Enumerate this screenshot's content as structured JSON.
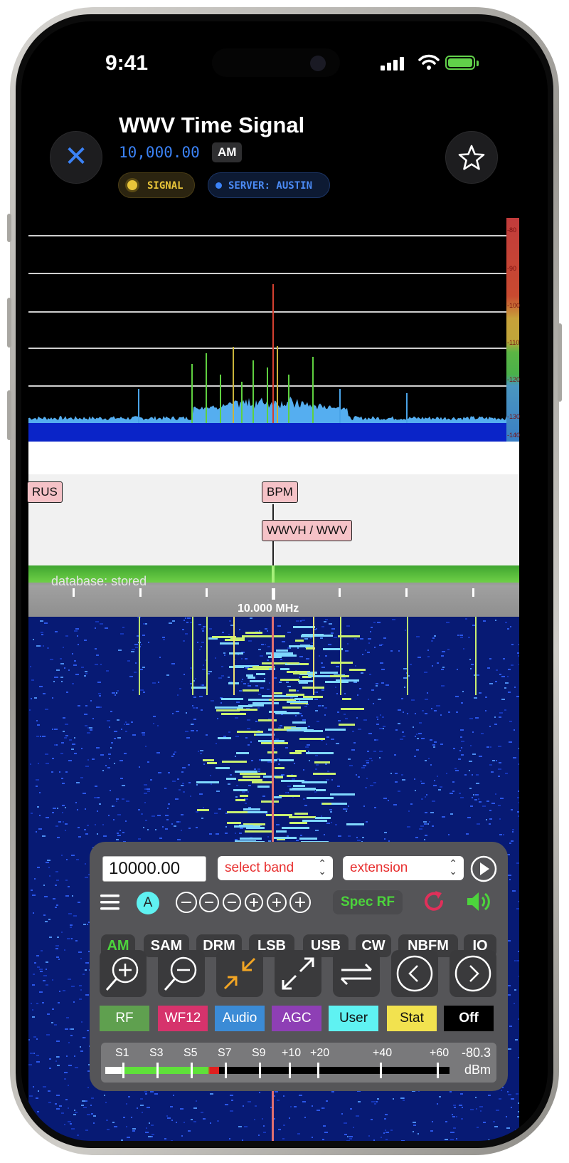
{
  "status": {
    "time": "9:41"
  },
  "header": {
    "title": "WWV Time Signal",
    "frequency": "10,000.00",
    "mode": "AM",
    "chips": {
      "signal": "SIGNAL",
      "server": "SERVER: AUSTIN"
    }
  },
  "spectrum": {
    "scale_labels": [
      "-80",
      "-90",
      "-100",
      "-110",
      "-120",
      "-130",
      "-140"
    ]
  },
  "stations": {
    "rus": "RUS",
    "bpm": "BPM",
    "wwv": "WWVH / WWV"
  },
  "ruler": {
    "database": "database: stored",
    "center": "10.000 MHz"
  },
  "controls": {
    "freq_input": "10000.00",
    "select_band": "select band",
    "extension": "extension",
    "a_badge": "A",
    "spec_rf": "Spec RF",
    "modes": [
      "AM",
      "SAM",
      "DRM",
      "LSB",
      "USB",
      "CW",
      "NBFM",
      "IQ"
    ],
    "color_buttons": [
      {
        "label": "RF",
        "bg": "#5fa04f",
        "fg": "#ffffff"
      },
      {
        "label": "WF12",
        "bg": "#d6336c",
        "fg": "#ffffff"
      },
      {
        "label": "Audio",
        "bg": "#3b8bd6",
        "fg": "#ffffff"
      },
      {
        "label": "AGC",
        "bg": "#8e3fb5",
        "fg": "#ffffff"
      },
      {
        "label": "User",
        "bg": "#5ff2f2",
        "fg": "#111111"
      },
      {
        "label": "Stat",
        "bg": "#f2e24f",
        "fg": "#111111"
      },
      {
        "label": "Off",
        "bg": "#000000",
        "fg": "#ffffff"
      }
    ],
    "meter_labels": [
      "S1",
      "S3",
      "S5",
      "S7",
      "S9",
      "+10",
      "+20",
      "+40",
      "+60"
    ],
    "meter_value": "-80.3",
    "meter_unit": "dBm",
    "signal_level": 0.33
  },
  "colors": {
    "accent": "#3b82f6",
    "signal_yellow": "#e9c53a",
    "spec_green": "#4cd43c"
  }
}
